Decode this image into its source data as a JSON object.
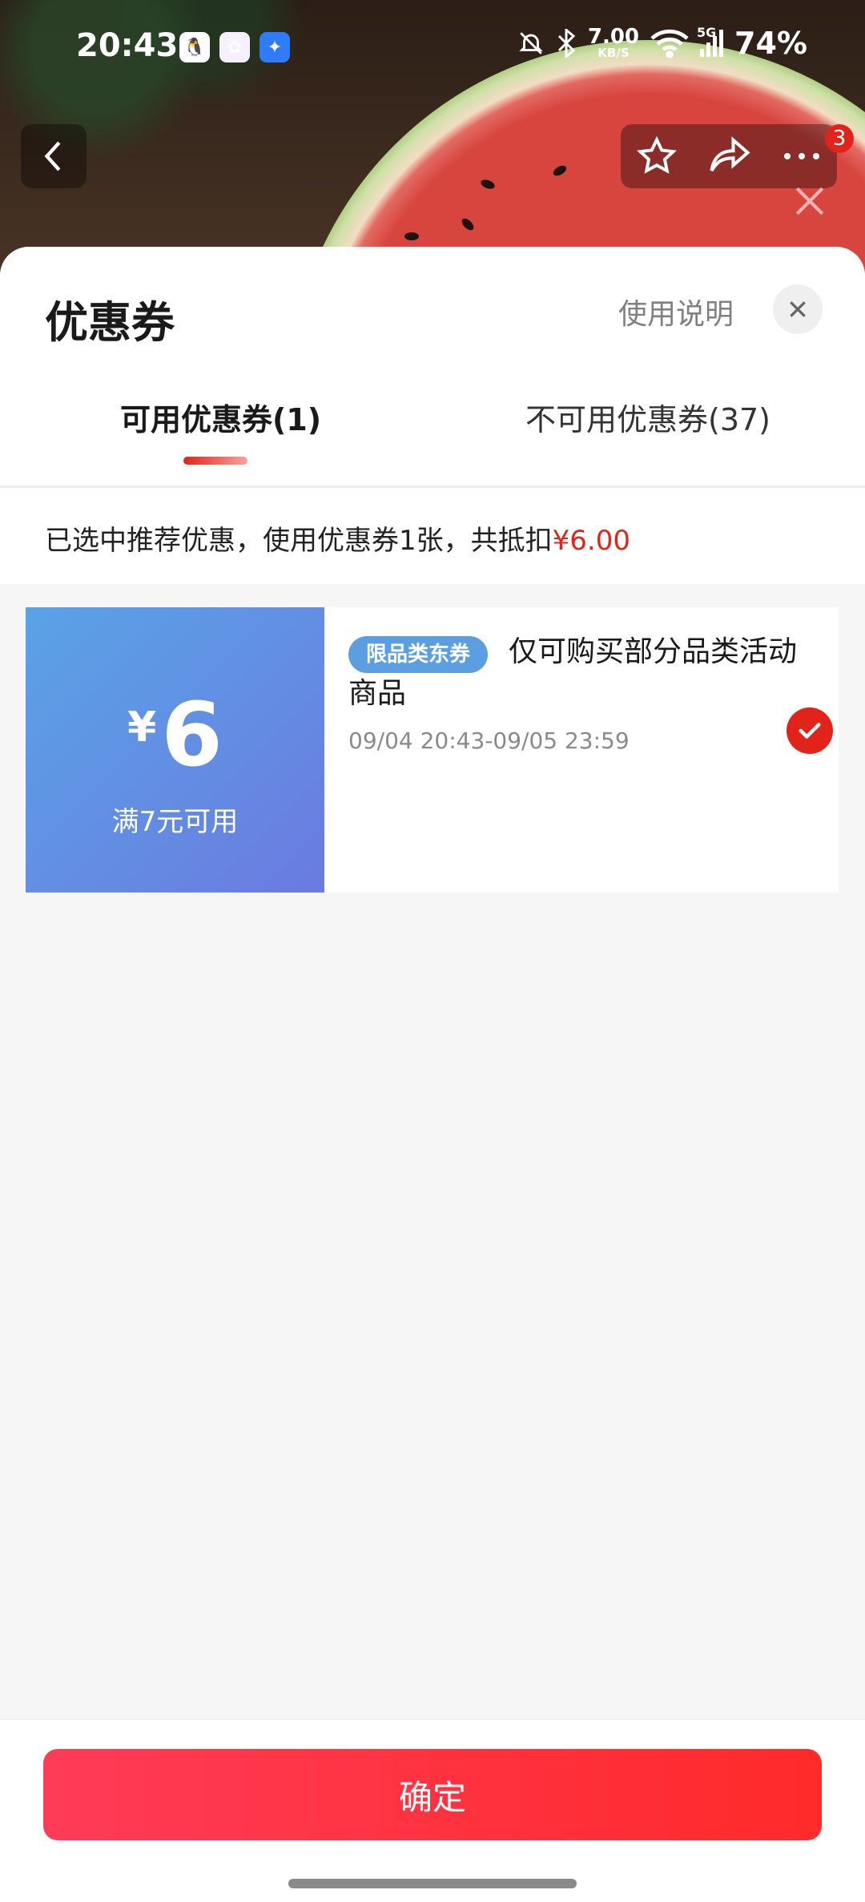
{
  "status_bar": {
    "time": "20:43",
    "net_speed_value": "7.00",
    "net_speed_unit": "KB/S",
    "network": "5G",
    "battery": "74%"
  },
  "nav": {
    "badge_count": "3"
  },
  "sheet": {
    "title": "优惠券",
    "usage_link": "使用说明",
    "tabs": [
      {
        "label": "可用优惠券(1)",
        "active": true
      },
      {
        "label": "不可用优惠券(37)",
        "active": false
      }
    ],
    "summary_prefix": "已选中推荐优惠，使用优惠券1张，共抵扣",
    "summary_amount": "¥6.00"
  },
  "coupon": {
    "currency": "¥",
    "value": "6",
    "condition": "满7元可用",
    "tag": "限品类东券",
    "description": "仅可购买部分品类活动商品",
    "valid_range": "09/04 20:43-09/05 23:59",
    "selected": true
  },
  "confirm_label": "确定",
  "colors": {
    "accent": "#e2231a",
    "coupon_gradient_start": "#5aa3e6",
    "coupon_gradient_end": "#6a7be0",
    "tag_blue": "#5c9fe0"
  }
}
